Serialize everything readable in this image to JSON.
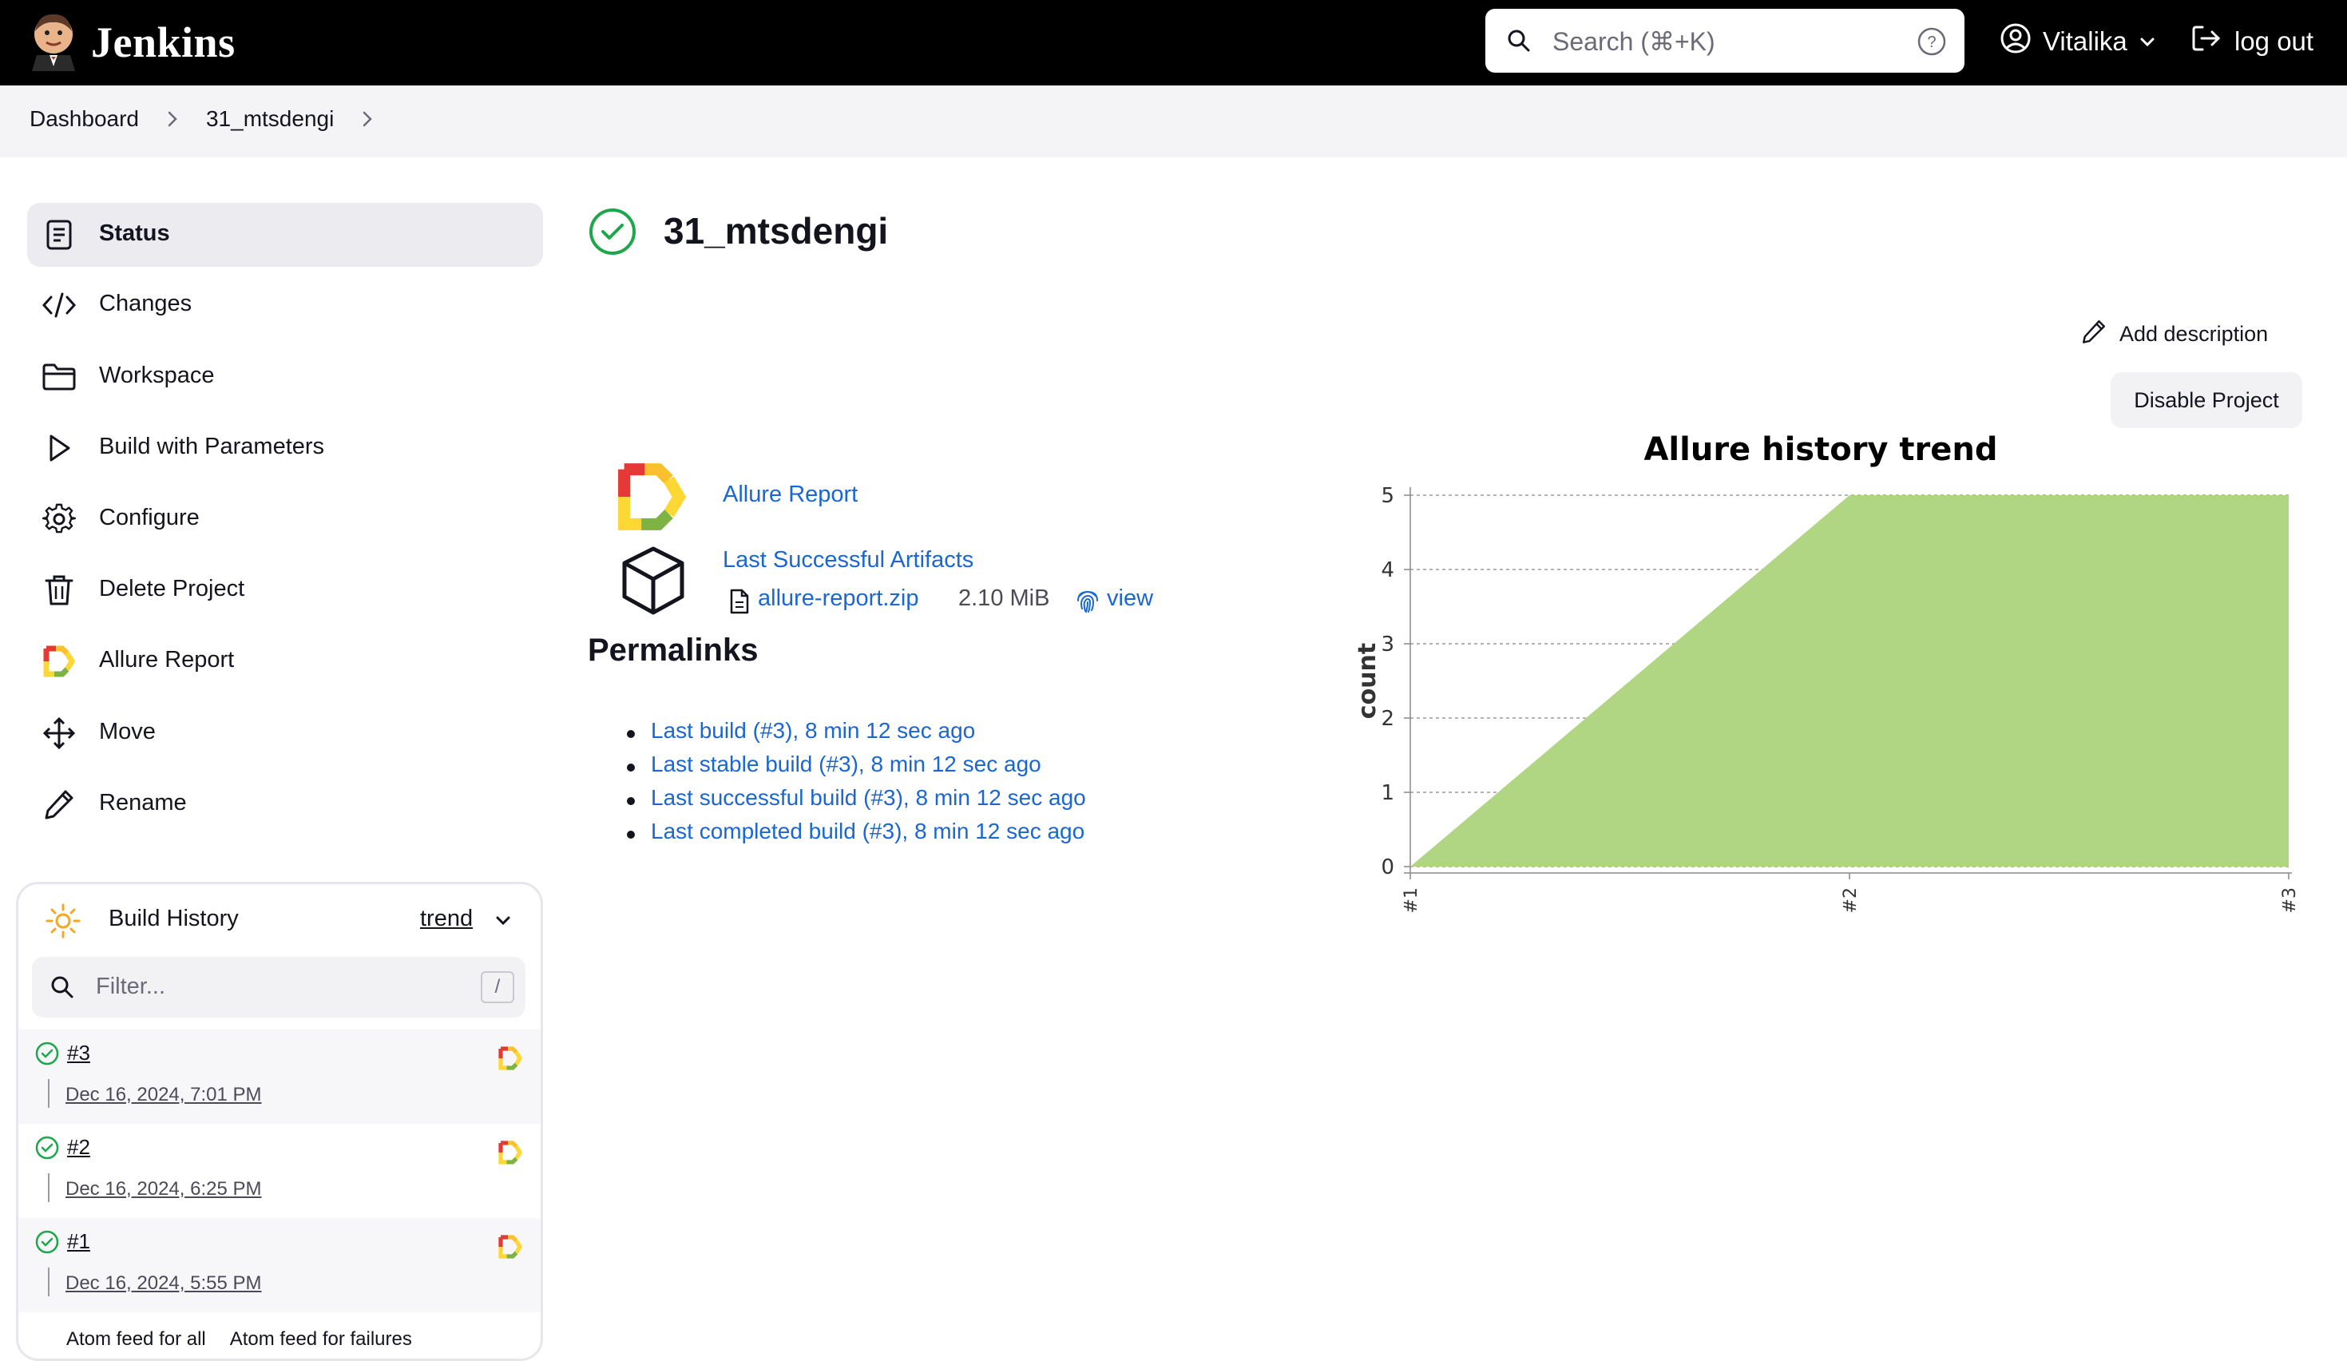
{
  "header": {
    "brand": "Jenkins",
    "search_placeholder": "Search (⌘+K)",
    "user": "Vitalika",
    "logout": "log out"
  },
  "breadcrumb": [
    "Dashboard",
    "31_mtsdengi"
  ],
  "sidebar": {
    "items": [
      {
        "label": "Status",
        "icon": "status-icon",
        "active": true
      },
      {
        "label": "Changes",
        "icon": "code-icon"
      },
      {
        "label": "Workspace",
        "icon": "folder-icon"
      },
      {
        "label": "Build with Parameters",
        "icon": "play-icon"
      },
      {
        "label": "Configure",
        "icon": "gear-icon"
      },
      {
        "label": "Delete Project",
        "icon": "trash-icon"
      },
      {
        "label": "Allure Report",
        "icon": "allure-icon"
      },
      {
        "label": "Move",
        "icon": "move-icon"
      },
      {
        "label": "Rename",
        "icon": "pencil-icon"
      }
    ]
  },
  "build_history": {
    "title": "Build History",
    "trend": "trend",
    "filter_placeholder": "Filter...",
    "filter_shortcut": "/",
    "runs": [
      {
        "number": "#3",
        "date": "Dec 16, 2024, 7:01 PM"
      },
      {
        "number": "#2",
        "date": "Dec 16, 2024, 6:25 PM"
      },
      {
        "number": "#1",
        "date": "Dec 16, 2024, 5:55 PM"
      }
    ],
    "feeds": [
      "Atom feed for all",
      "Atom feed for failures"
    ]
  },
  "main": {
    "title": "31_mtsdengi",
    "add_description": "Add description",
    "disable_project": "Disable Project",
    "allure_report": "Allure Report",
    "last_successful_artifacts": "Last Successful Artifacts",
    "artifact_name": "allure-report.zip",
    "artifact_size": "2.10 MiB",
    "artifact_view": "view",
    "permalinks_title": "Permalinks",
    "permalinks": [
      "Last build (#3), 8 min 12 sec ago",
      "Last stable build (#3), 8 min 12 sec ago",
      "Last successful build (#3), 8 min 12 sec ago",
      "Last completed build (#3), 8 min 12 sec ago"
    ]
  },
  "chart_data": {
    "type": "area",
    "title": "Allure history trend",
    "xlabel": "",
    "ylabel": "count",
    "categories": [
      "#1",
      "#2",
      "#3"
    ],
    "series": [
      {
        "values": [
          0,
          5,
          5
        ],
        "color": "#b0d683"
      }
    ],
    "ylim": [
      0,
      5
    ],
    "yticks": [
      0,
      1,
      2,
      3,
      4,
      5
    ],
    "grid": true
  },
  "colors": {
    "header_bg": "#000000",
    "link": "#1a67d2",
    "success": "#1ea64b",
    "chart_fill": "#b0d683"
  }
}
